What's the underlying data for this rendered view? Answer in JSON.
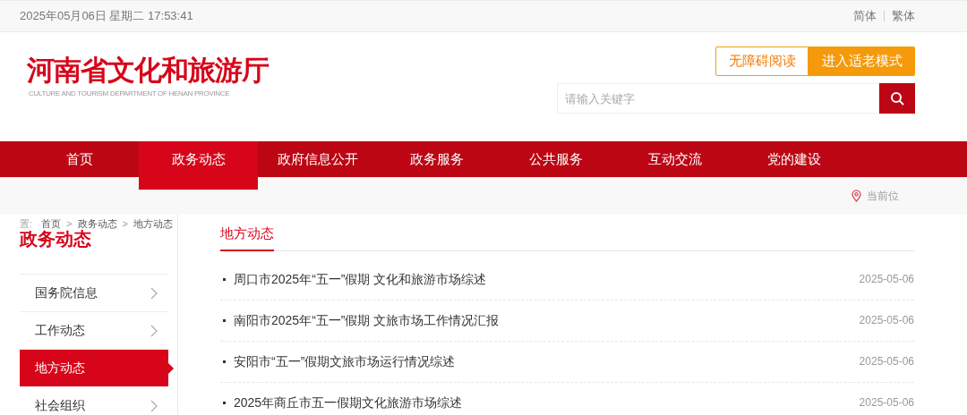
{
  "top_bar": {
    "datetime": "2025年05月06日 星期二 17:53:41",
    "languages": [
      {
        "label": "简体",
        "selected": false
      },
      {
        "label": "繁体",
        "selected": false
      }
    ]
  },
  "header": {
    "logo_title": "河南省文化和旅游厅",
    "logo_subtitle": "CULTURE AND TOURISM DEPARTMENT OF HENAN PROVINCE",
    "accessibility_button": "无障碍阅读",
    "elderly_mode_button": "进入适老模式",
    "search": {
      "placeholder": "请输入关键字"
    }
  },
  "nav": [
    {
      "label": "首页",
      "selected": false
    },
    {
      "label": "政务动态",
      "selected": true,
      "dropdown": true
    },
    {
      "label": "政府信息公开",
      "selected": false
    },
    {
      "label": "政务服务",
      "selected": false
    },
    {
      "label": "公共服务",
      "selected": false
    },
    {
      "label": "互动交流",
      "selected": false
    },
    {
      "label": "党的建设",
      "selected": false
    }
  ],
  "location_bar": {
    "label": "当前位"
  },
  "breadcrumb": {
    "prefix": "置:",
    "items": [
      "首页",
      "政务动态",
      "地方动态"
    ],
    "separator": ">"
  },
  "sidebar": {
    "title": "政务动态",
    "items": [
      {
        "label": "国务院信息",
        "selected": false
      },
      {
        "label": "工作动态",
        "selected": false
      },
      {
        "label": "地方动态",
        "selected": true
      },
      {
        "label": "社会组织",
        "selected": false
      }
    ]
  },
  "content": {
    "tab": "地方动态",
    "articles": [
      {
        "title": "周口市2025年“五一”假期 文化和旅游市场综述",
        "date": "2025-05-06"
      },
      {
        "title": "南阳市2025年“五一”假期 文旅市场工作情况汇报",
        "date": "2025-05-06"
      },
      {
        "title": "安阳市“五一”假期文旅市场运行情况综述",
        "date": "2025-05-06"
      },
      {
        "title": "2025年商丘市五一假期文化旅游市场综述",
        "date": "2025-05-06"
      }
    ]
  }
}
